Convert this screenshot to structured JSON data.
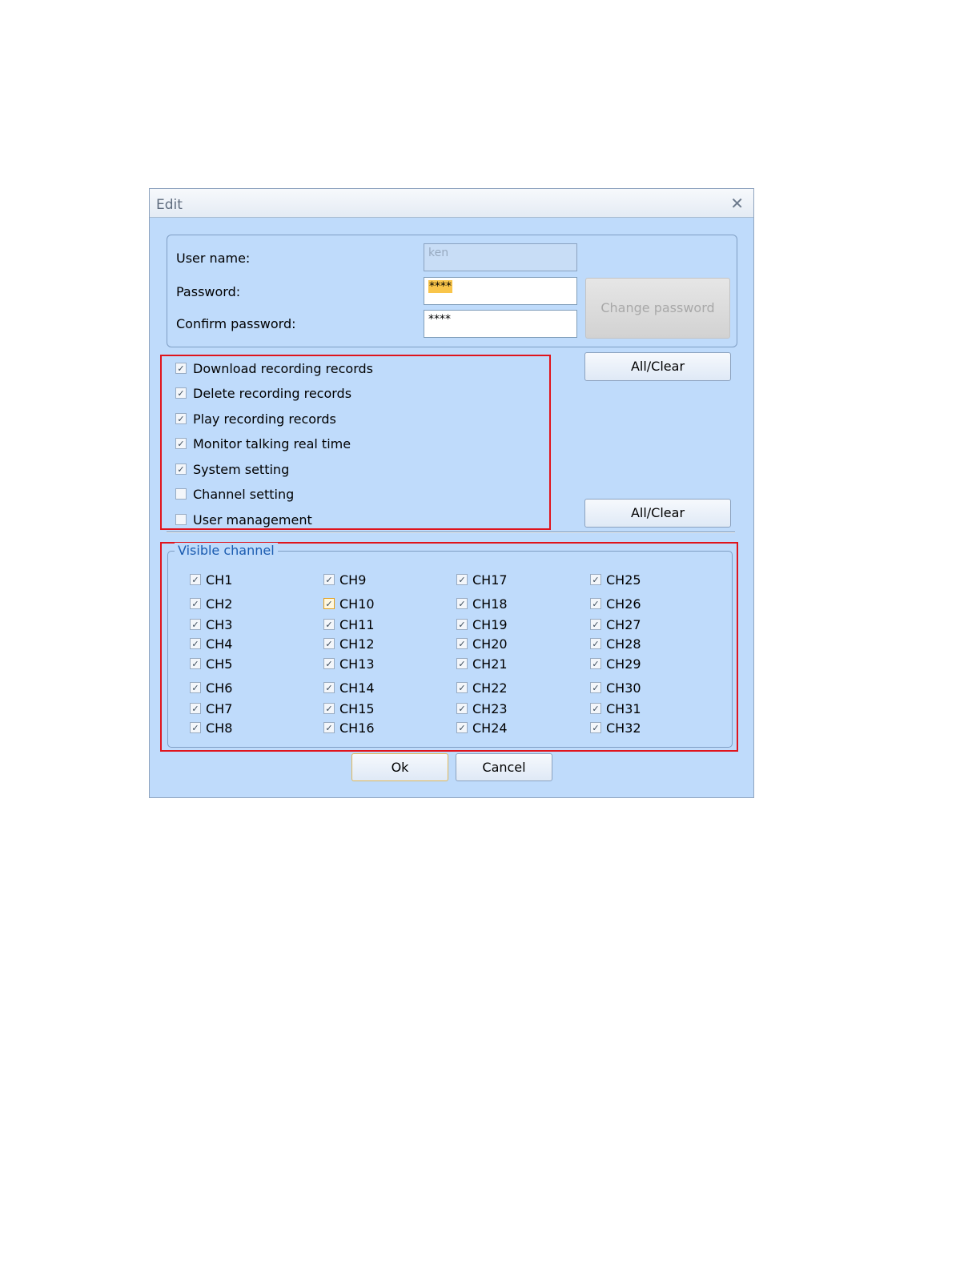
{
  "dialog": {
    "title": "Edit",
    "close_glyph": "✕",
    "user_name_label": "User name:",
    "user_name_value": "ken",
    "password_label": "Password:",
    "password_value": "****",
    "confirm_label": "Confirm password:",
    "confirm_value": "****",
    "change_password_label": "Change password",
    "all_clear_label": "All/Clear",
    "all_clear_label_2": "All/Clear",
    "ok_label": "Ok",
    "cancel_label": "Cancel"
  },
  "permissions": [
    {
      "label": "Download recording records",
      "checked": true
    },
    {
      "label": "Delete recording records",
      "checked": true
    },
    {
      "label": "Play recording records",
      "checked": true
    },
    {
      "label": "Monitor talking real time",
      "checked": true
    },
    {
      "label": "System setting",
      "checked": true
    },
    {
      "label": "Channel setting",
      "checked": false
    },
    {
      "label": "User management",
      "checked": false
    }
  ],
  "visible_channel": {
    "legend": "Visible channel",
    "channels": [
      {
        "label": "CH1",
        "checked": true
      },
      {
        "label": "CH2",
        "checked": true
      },
      {
        "label": "CH3",
        "checked": true
      },
      {
        "label": "CH4",
        "checked": true
      },
      {
        "label": "CH5",
        "checked": true
      },
      {
        "label": "CH6",
        "checked": true
      },
      {
        "label": "CH7",
        "checked": true
      },
      {
        "label": "CH8",
        "checked": true
      },
      {
        "label": "CH9",
        "checked": true
      },
      {
        "label": "CH10",
        "checked": true,
        "highlight": true
      },
      {
        "label": "CH11",
        "checked": true
      },
      {
        "label": "CH12",
        "checked": true
      },
      {
        "label": "CH13",
        "checked": true
      },
      {
        "label": "CH14",
        "checked": true
      },
      {
        "label": "CH15",
        "checked": true
      },
      {
        "label": "CH16",
        "checked": true
      },
      {
        "label": "CH17",
        "checked": true
      },
      {
        "label": "CH18",
        "checked": true
      },
      {
        "label": "CH19",
        "checked": true
      },
      {
        "label": "CH20",
        "checked": true
      },
      {
        "label": "CH21",
        "checked": true
      },
      {
        "label": "CH22",
        "checked": true
      },
      {
        "label": "CH23",
        "checked": true
      },
      {
        "label": "CH24",
        "checked": true
      },
      {
        "label": "CH25",
        "checked": true
      },
      {
        "label": "CH26",
        "checked": true
      },
      {
        "label": "CH27",
        "checked": true
      },
      {
        "label": "CH28",
        "checked": true
      },
      {
        "label": "CH29",
        "checked": true
      },
      {
        "label": "CH30",
        "checked": true
      },
      {
        "label": "CH31",
        "checked": true
      },
      {
        "label": "CH32",
        "checked": true
      }
    ]
  },
  "icons": {
    "checkmark": "✓",
    "close": "close-icon"
  },
  "colors": {
    "dialog_bg": "#bfdbfb",
    "highlight_border": "#e0141c",
    "password_highlight": "#f9c54a"
  }
}
